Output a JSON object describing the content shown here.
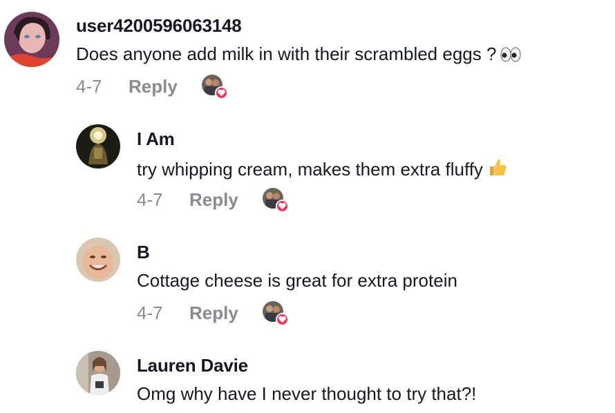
{
  "comments": [
    {
      "username": "user4200596063148",
      "text": "Does anyone add milk in with their scrambled eggs ?",
      "emoji": "eyes-emoji",
      "date": "4-7",
      "reply_label": "Reply",
      "liked_by_creator": true
    },
    {
      "username": "I Am",
      "text": "try whipping cream, makes them extra fluffy",
      "emoji": "thumbs-up-emoji",
      "date": "4-7",
      "reply_label": "Reply",
      "liked_by_creator": true
    },
    {
      "username": "B",
      "text": "Cottage cheese is great for extra protein",
      "date": "4-7",
      "reply_label": "Reply",
      "liked_by_creator": true
    },
    {
      "username": "Lauren Davie",
      "text": "Omg why have I never thought to try that?!"
    }
  ],
  "colors": {
    "username": "#161823",
    "meta": "#8a8b91",
    "heart_badge": "#fe2c55"
  }
}
